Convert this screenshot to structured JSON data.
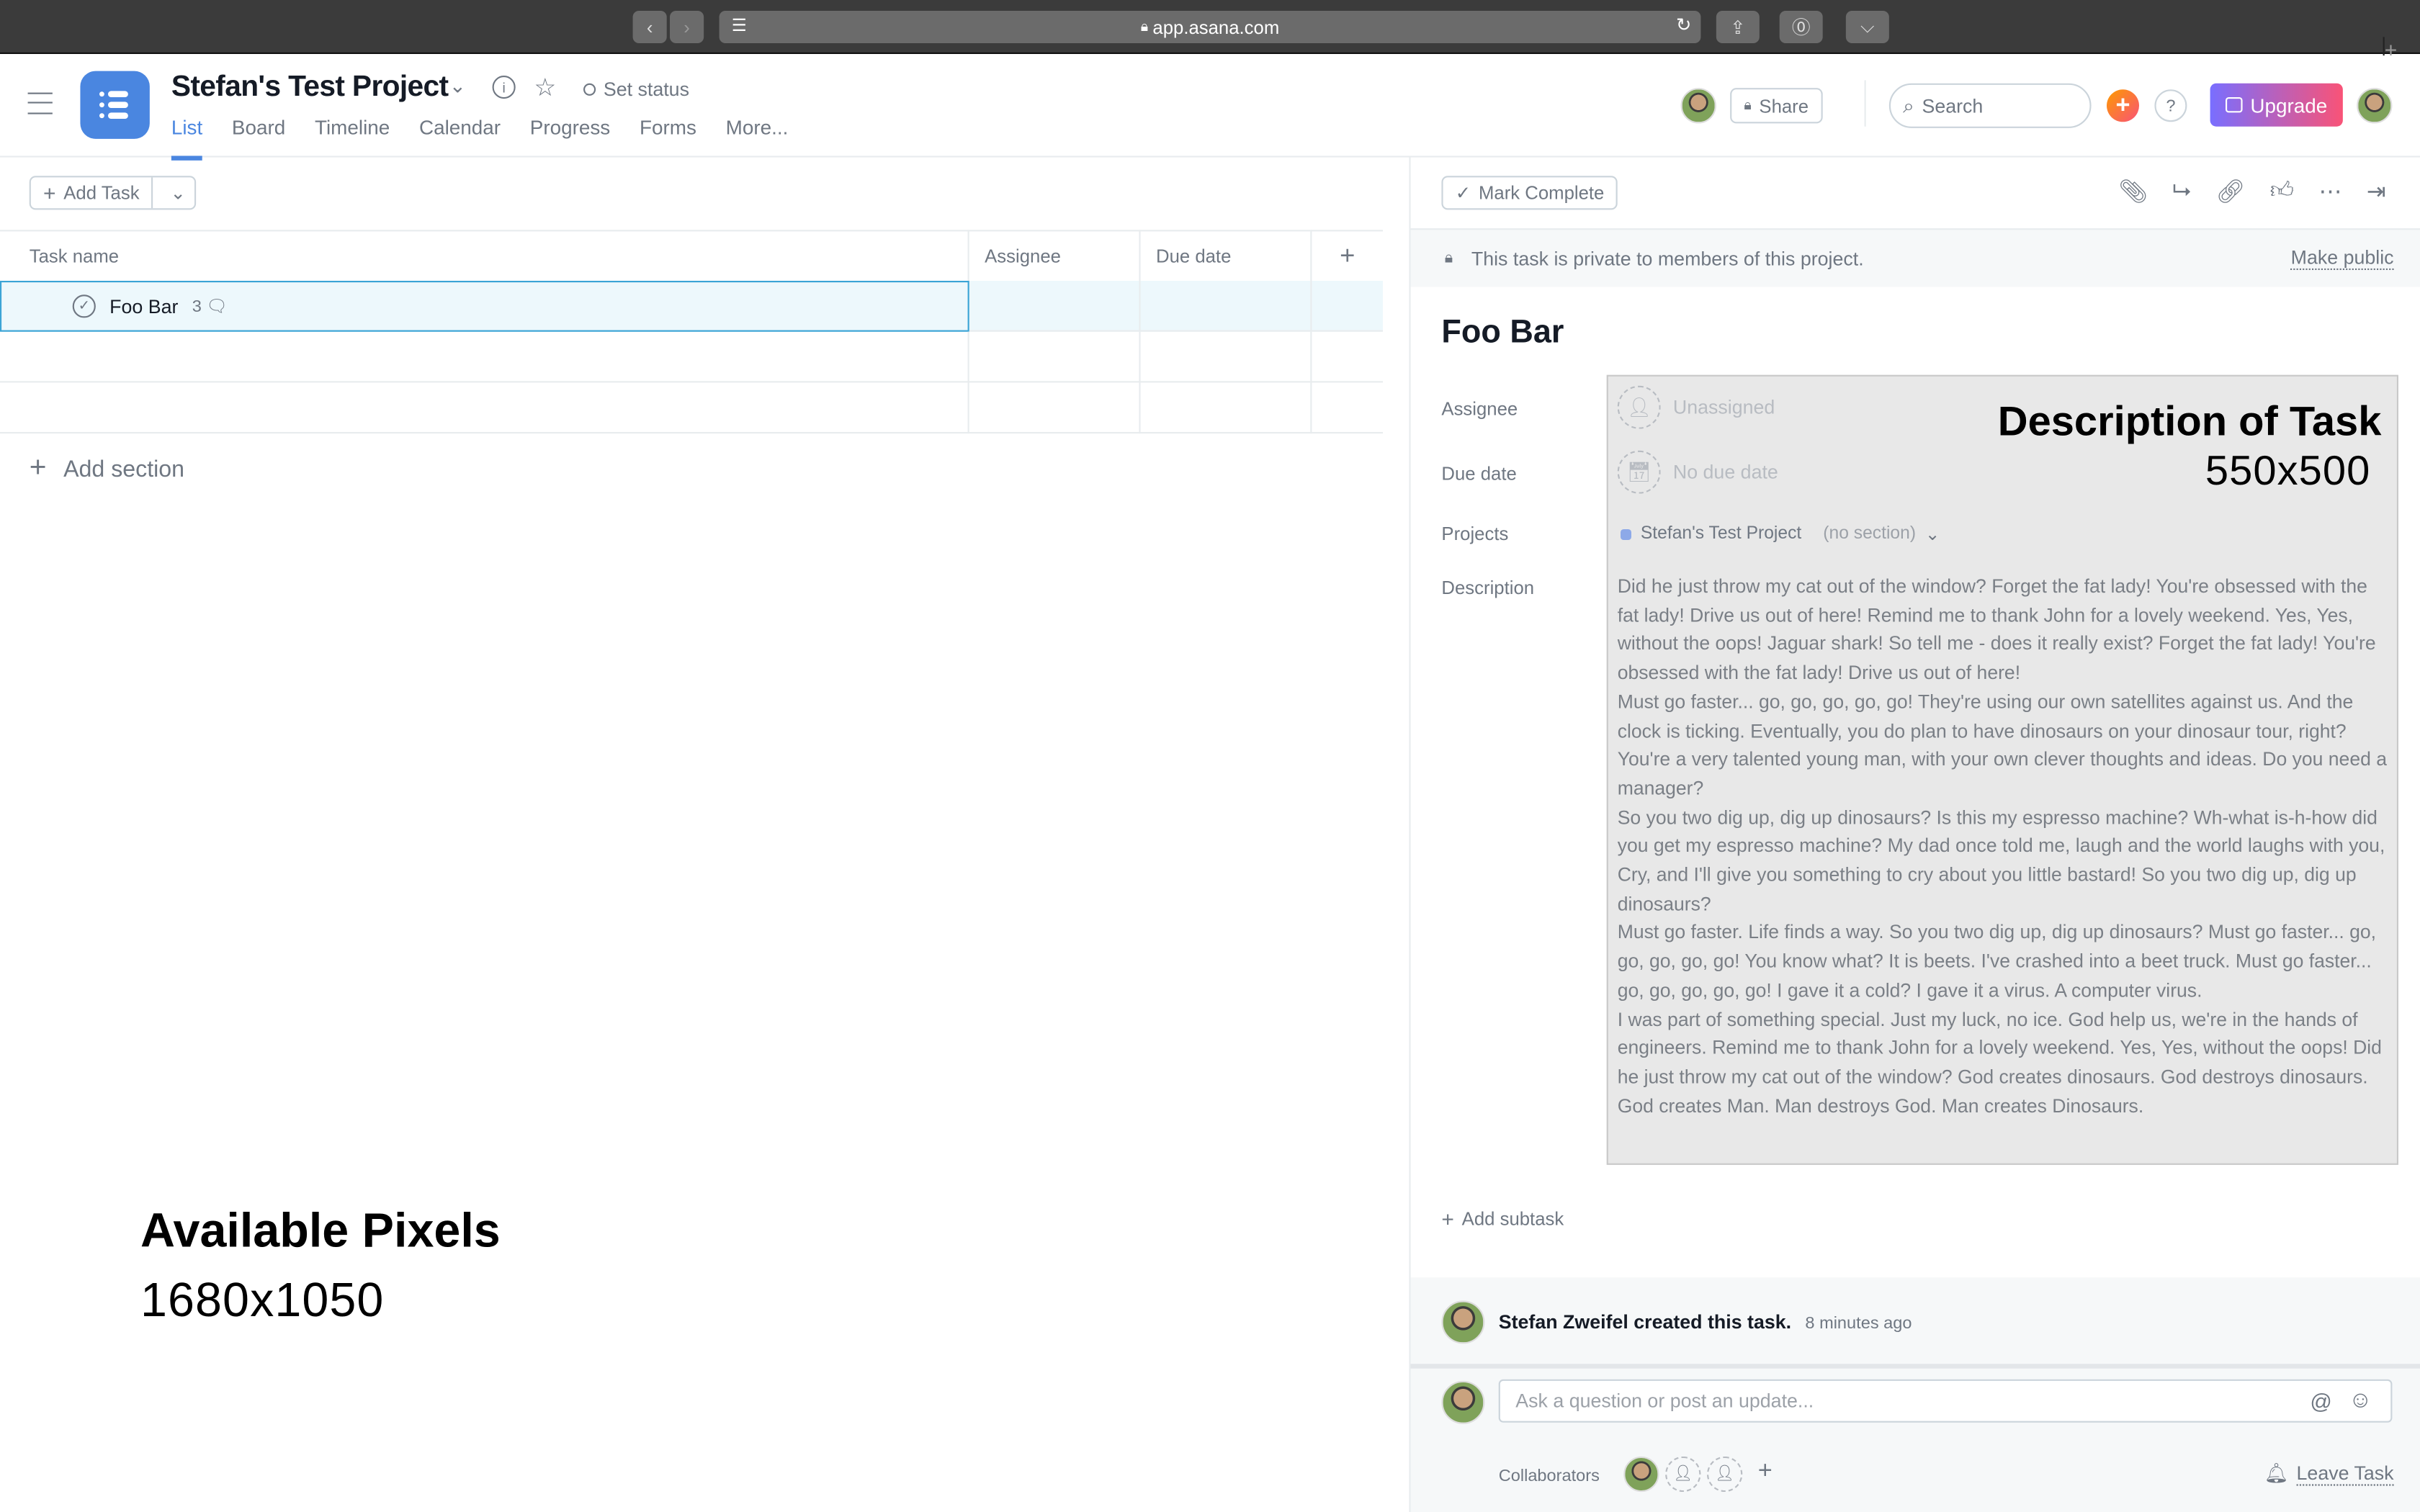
{
  "browser": {
    "url": "app.asana.com"
  },
  "header": {
    "project_title": "Stefan's Test Project",
    "set_status": "Set status",
    "tabs": [
      {
        "label": "List",
        "active": true
      },
      {
        "label": "Board"
      },
      {
        "label": "Timeline"
      },
      {
        "label": "Calendar"
      },
      {
        "label": "Progress"
      },
      {
        "label": "Forms"
      },
      {
        "label": "More..."
      }
    ],
    "share": "Share",
    "search_placeholder": "Search",
    "upgrade": "Upgrade",
    "help": "?"
  },
  "colors": {
    "accent": "#4a86e0",
    "selected_row": "#edf8fc",
    "selected_border": "#3ba4d6",
    "banner_bg": "#f6f8f9",
    "upgrade_gradient": [
      "#796eff",
      "#f95377"
    ]
  },
  "list": {
    "add_task": "Add Task",
    "columns": [
      "Task name",
      "Assignee",
      "Due date"
    ],
    "tasks": [
      {
        "name": "Foo Bar",
        "comments": "3",
        "selected": true
      }
    ],
    "add_section": "Add section"
  },
  "overlay_left": {
    "title": "Available Pixels",
    "size": "1680x1050"
  },
  "task": {
    "mark_complete": "Mark Complete",
    "private_notice": "This task is private to members of this project.",
    "make_public": "Make public",
    "title": "Foo Bar",
    "fields": {
      "assignee_label": "Assignee",
      "assignee_value": "Unassigned",
      "due_label": "Due date",
      "due_value": "No due date",
      "projects_label": "Projects",
      "project_name": "Stefan's Test Project",
      "project_section": "(no section)",
      "description_label": "Description"
    },
    "description": [
      "Did he just throw my cat out of the window? Forget the fat lady! You're obsessed with the fat lady! Drive us out of here! Remind me to thank John for a lovely weekend. Yes, Yes, without the oops! Jaguar shark! So tell me - does it really exist? Forget the fat lady! You're obsessed with the fat lady! Drive us out of here!",
      "Must go faster... go, go, go, go, go! They're using our own satellites against us. And the clock is ticking. Eventually, you do plan to have dinosaurs on your dinosaur tour, right? You're a very talented young man, with your own clever thoughts and ideas. Do you need a manager?",
      "So you two dig up, dig up dinosaurs? Is this my espresso machine? Wh-what is-h-how did you get my espresso machine? My dad once told me, laugh and the world laughs with you, Cry, and I'll give you something to cry about you little bastard! So you two dig up, dig up dinosaurs?",
      "Must go faster. Life finds a way. So you two dig up, dig up dinosaurs? Must go faster... go, go, go, go, go! You know what? It is beets. I've crashed into a beet truck. Must go faster... go, go, go, go, go! I gave it a cold? I gave it a virus. A computer virus.",
      "I was part of something special. Just my luck, no ice. God help us, we're in the hands of engineers. Remind me to thank John for a lovely weekend. Yes, Yes, without the oops! Did he just throw my cat out of the window? God creates dinosaurs. God destroys dinosaurs. God creates Man. Man destroys God. Man creates Dinosaurs."
    ],
    "overlay": {
      "title": "Description of Task",
      "size": "550x500"
    },
    "add_subtask": "Add subtask",
    "activity": {
      "author_action": "Stefan Zweifel created this task.",
      "time": "8 minutes ago"
    },
    "comment_placeholder": "Ask a question or post an update...",
    "collaborators_label": "Collaborators",
    "leave_task": "Leave Task"
  }
}
